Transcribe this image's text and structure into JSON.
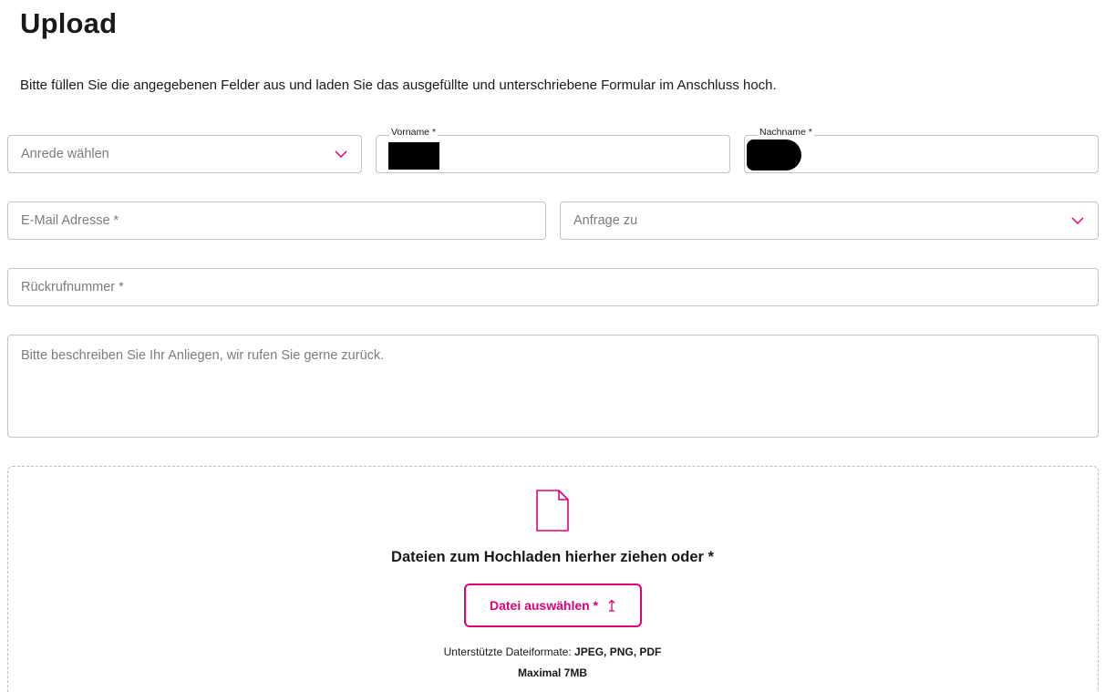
{
  "page": {
    "title": "Upload",
    "intro": "Bitte füllen Sie die angegebenen Felder aus und laden Sie das ausgefüllte und unterschriebene Formular im Anschluss hoch."
  },
  "form": {
    "salutation": {
      "placeholder": "Anrede wählen",
      "icon": "chevron-down-icon"
    },
    "first_name": {
      "label": "Vorname *",
      "value": ""
    },
    "last_name": {
      "label": "Nachname *",
      "value": ""
    },
    "email": {
      "placeholder": "E-Mail Adresse *"
    },
    "inquiry": {
      "placeholder": "Anfrage zu",
      "icon": "chevron-down-icon"
    },
    "callback": {
      "placeholder": "Rückrufnummer *"
    },
    "message": {
      "placeholder": "Bitte beschreiben Sie Ihr Anliegen, wir rufen Sie gerne zurück."
    }
  },
  "upload": {
    "icon": "file-icon",
    "drop_text": "Dateien zum Hochladen hierher ziehen oder *",
    "button_label": "Datei auswählen *",
    "button_icon": "upload-arrow-icon",
    "formats_label": "Unterstützte Dateiformate:",
    "formats_value": "JPEG, PNG, PDF",
    "max_size": "Maximal 7MB"
  },
  "colors": {
    "accent": "#e20074",
    "border": "#c4c4c4",
    "text": "#191919",
    "placeholder": "#7c7c7c"
  }
}
